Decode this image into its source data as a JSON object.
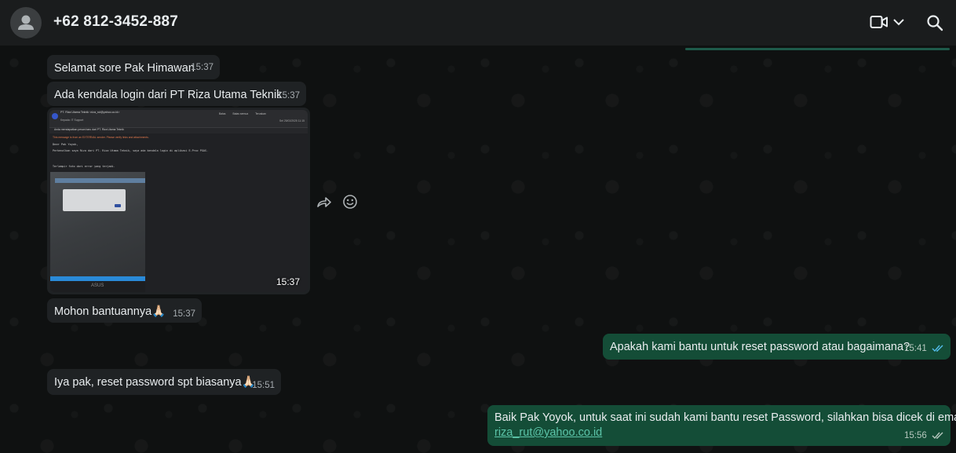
{
  "header": {
    "contact_name": "+62 812-3452-887",
    "avatar_icon": "person-icon",
    "video_call_icon": "video-camera-icon",
    "dropdown_icon": "chevron-down-icon",
    "search_icon": "search-icon"
  },
  "colors": {
    "incoming_bubble": "#1f2224",
    "outgoing_bubble": "#144d37",
    "link": "#5cc5a9",
    "read_ticks": "#53bdeb"
  },
  "messages": [
    {
      "direction": "in",
      "text": "Selamat sore Pak Himawan",
      "time": "15:37"
    },
    {
      "direction": "in",
      "text": "Ada kendala login dari PT Riza Utama Teknik",
      "time": "15:37"
    },
    {
      "direction": "in",
      "type": "image",
      "time": "15:37",
      "content": "email screenshot with photo of laptop screen"
    },
    {
      "direction": "in",
      "text": "Mohon bantuannya🙏🏻",
      "time": "15:37"
    },
    {
      "direction": "out",
      "text": "Apakah kami bantu untuk reset password atau bagaimana?",
      "time": "15:41",
      "status": "read"
    },
    {
      "direction": "in",
      "text": "Iya pak, reset password spt biasanya🙏🏻",
      "time": "15:51"
    },
    {
      "direction": "out",
      "text": "Baik Pak Yoyok, untuk saat ini sudah kami bantu reset Password, silahkan bisa dicek di email",
      "link": "riza_rut@yahoo.co.id",
      "time": "15:56",
      "status": "delivered"
    }
  ],
  "hover_actions": {
    "forward_icon": "forward-icon",
    "react_icon": "emoji-smile-icon"
  },
  "email_preview": {
    "sender": "PT. Riza Utama Teknik <riza_rut@yahoo.co.id>",
    "to": "Kepada: IT Support",
    "subject": "Anda mendapatkan pesan baru dari PT. Riza Utama Teknik",
    "toolbar": [
      "Balas",
      "Balas semua",
      "Teruskan"
    ],
    "date": "Sel 25/02/2025 11:15",
    "warning": "This message is from an EXTERNAL sender. Please verify links and attachments.",
    "greeting": "Dear Pak Yoyok,",
    "body": "Perkenalkan saya Riza dari PT. Riza Utama Teknik, saya ada kendala login di aplikasi E-Proc PGAS.",
    "closing": "Terlampir foto dari error yang terjadi.",
    "laptop_brand": "ASUS"
  }
}
